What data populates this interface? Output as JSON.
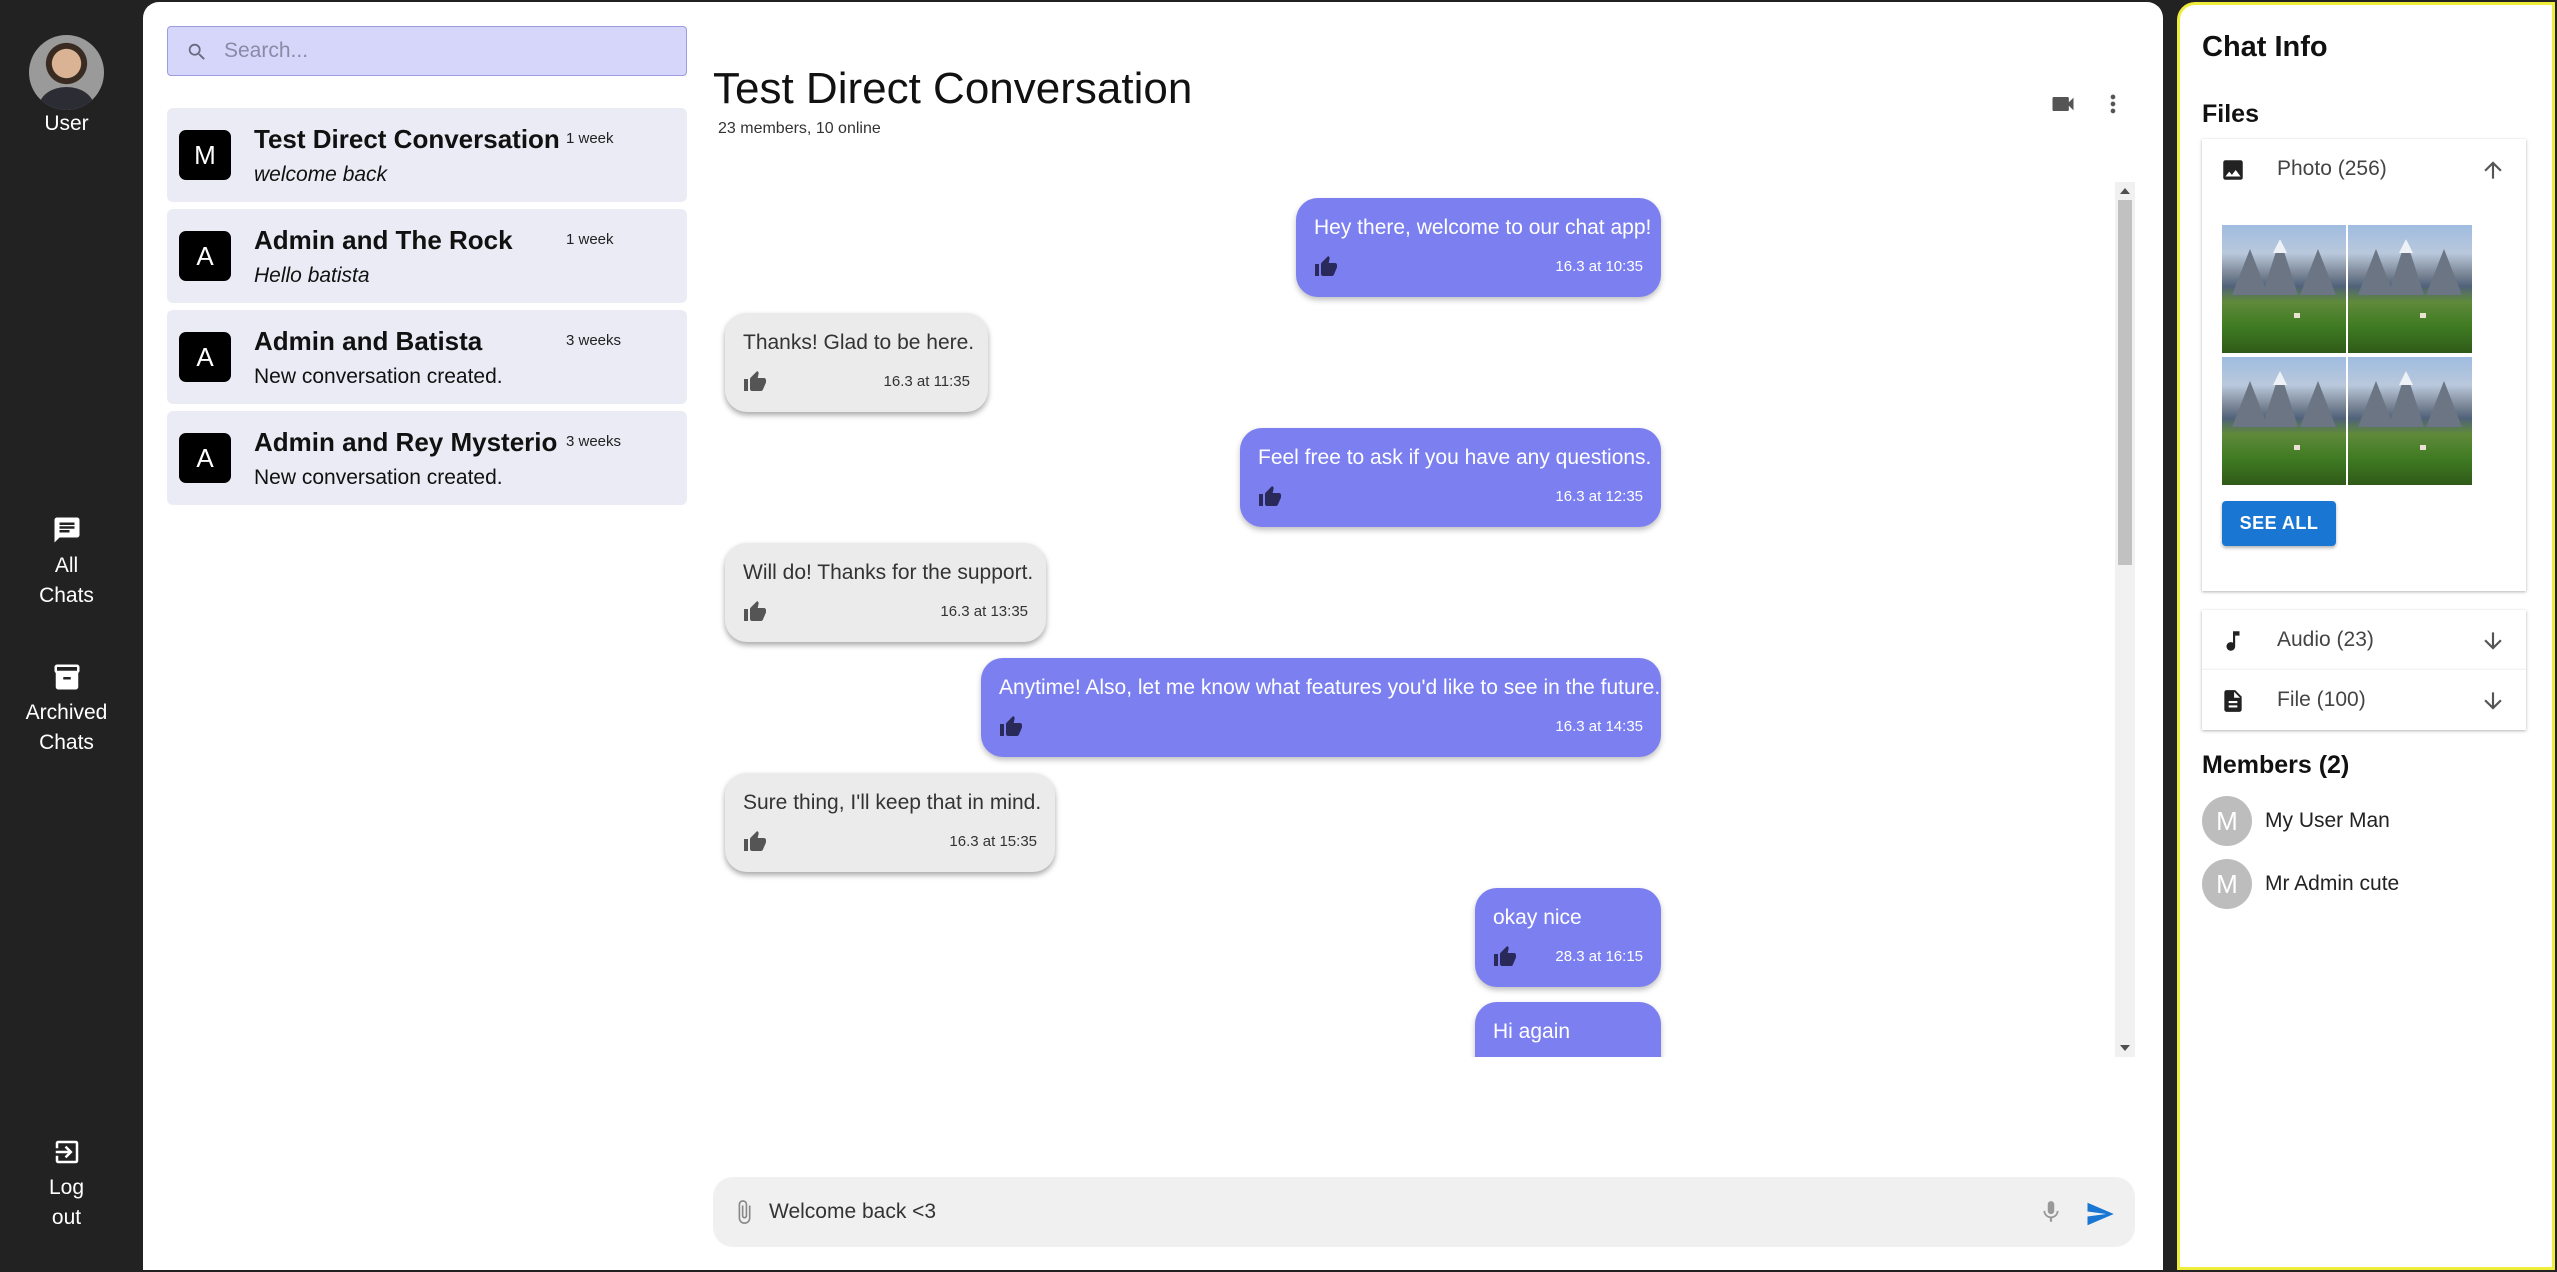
{
  "nav": {
    "user_label": "User",
    "all_chats": [
      "All",
      "Chats"
    ],
    "archived_chats": [
      "Archived",
      "Chats"
    ],
    "logout": [
      "Log",
      "out"
    ]
  },
  "search": {
    "placeholder": "Search..."
  },
  "conversations": [
    {
      "letter": "M",
      "title": "Test Direct Conversation",
      "time": "1 week",
      "preview": "welcome back",
      "italic": true
    },
    {
      "letter": "A",
      "title": "Admin and The Rock",
      "time": "1 week",
      "preview": "Hello batista",
      "italic": true
    },
    {
      "letter": "A",
      "title": "Admin and Batista",
      "time": "3 weeks",
      "preview": "New conversation created.",
      "italic": false
    },
    {
      "letter": "A",
      "title": "Admin and Rey Mysterio",
      "time": "3 weeks",
      "preview": "New conversation created.",
      "italic": false
    }
  ],
  "chat": {
    "title": "Test Direct Conversation",
    "subtitle": "23 members, 10 online",
    "messages": [
      {
        "dir": "out",
        "text": "Hey there, welcome to our chat app!",
        "time": "16.3 at 10:35"
      },
      {
        "dir": "in",
        "text": "Thanks! Glad to be here.",
        "time": "16.3 at 11:35"
      },
      {
        "dir": "out",
        "text": "Feel free to ask if you have any questions.",
        "time": "16.3 at 12:35"
      },
      {
        "dir": "in",
        "text": "Will do! Thanks for the support.",
        "time": "16.3 at 13:35"
      },
      {
        "dir": "out",
        "text": "Anytime! Also, let me know what features you'd like to see in the future.",
        "time": "16.3 at 14:35"
      },
      {
        "dir": "in",
        "text": "Sure thing, I'll keep that in mind.",
        "time": "16.3 at 15:35"
      },
      {
        "dir": "out",
        "text": "okay nice",
        "time": "28.3 at 16:15"
      },
      {
        "dir": "out",
        "text": "Hi again",
        "time": ""
      }
    ],
    "composer_value": "Welcome back <3"
  },
  "info": {
    "title": "Chat Info",
    "files_heading": "Files",
    "photo_label": "Photo (256)",
    "see_all": "SEE ALL",
    "audio_label": "Audio (23)",
    "file_label": "File (100)",
    "members_heading": "Members (2)",
    "members": [
      {
        "initial": "M",
        "name": "My User Man"
      },
      {
        "initial": "M",
        "name": "Mr Admin cute"
      }
    ]
  },
  "colors": {
    "outgoing_bubble": "#7b7ff0",
    "incoming_bubble": "#ebebeb",
    "nav_background": "#222222",
    "send_accent": "#1976d2",
    "info_border": "#f0ec3c"
  }
}
